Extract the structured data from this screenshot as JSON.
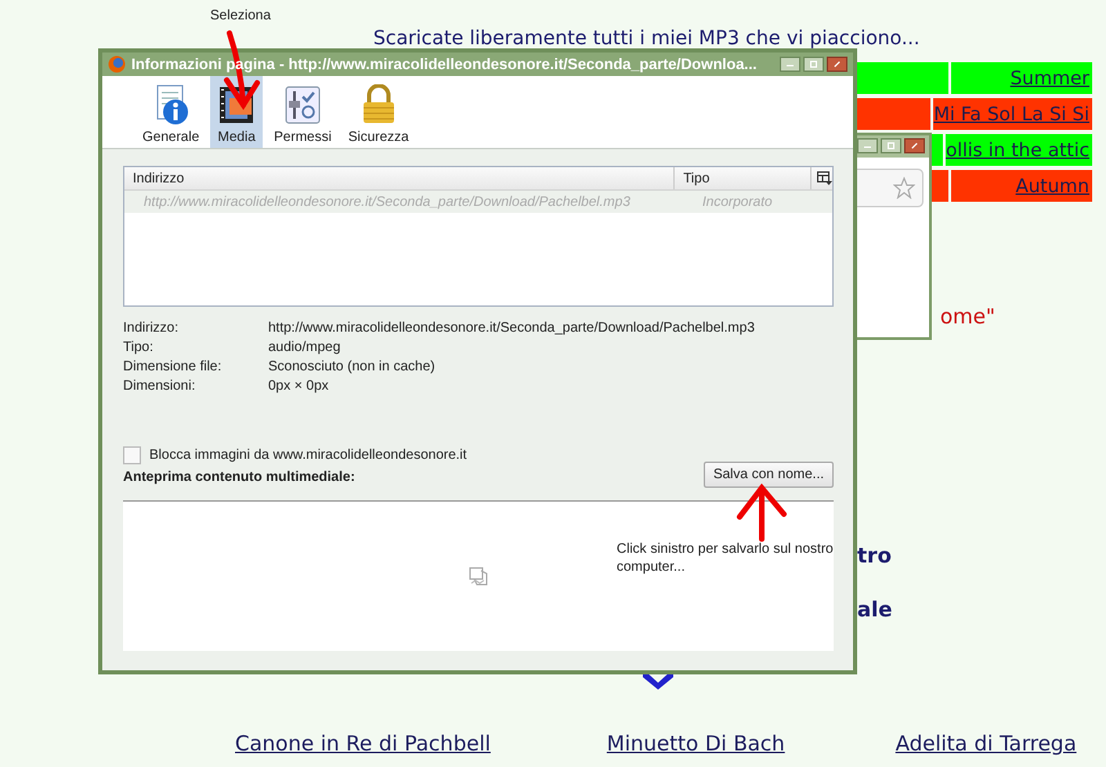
{
  "page": {
    "heading": "Scaricate liberamente tutti i miei MP3 che vi piacciono...",
    "table_rows": [
      {
        "label": "Summer",
        "color": "#00ff00"
      },
      {
        "label": "Mi Fa Sol La Si Si",
        "color": "#ff3300"
      },
      {
        "label": "ollis in the attic",
        "color": "#00ff00"
      },
      {
        "label": "Autumn",
        "color": "#ff3300"
      }
    ],
    "fragments": [
      {
        "text": "ome\"",
        "kind": "red"
      },
      {
        "text": "tro",
        "kind": "bold"
      },
      {
        "text": "ale",
        "kind": "bold"
      }
    ],
    "links": [
      "Canone in Re di Pachbell",
      "Minuetto Di Bach",
      "Adelita di Tarrega"
    ]
  },
  "annotations": {
    "top_label": "Seleziona",
    "note": "Click sinistro per salvarlo sul nostro computer..."
  },
  "dialog": {
    "title": "Informazioni pagina - http://www.miracolidelleondesonore.it/Seconda_parte/Downloa...",
    "tabs": [
      {
        "label": "Generale",
        "kind": "info",
        "selected": false
      },
      {
        "label": "Media",
        "kind": "media",
        "selected": true
      },
      {
        "label": "Permessi",
        "kind": "perm",
        "selected": false
      },
      {
        "label": "Sicurezza",
        "kind": "lock",
        "selected": false
      }
    ],
    "columns": [
      "Indirizzo",
      "Tipo"
    ],
    "rows": [
      {
        "address": "http://www.miracolidelleondesonore.it/Seconda_parte/Download/Pachelbel.mp3",
        "type": "Incorporato"
      }
    ],
    "fields": [
      {
        "label": "Indirizzo:",
        "value": "http://www.miracolidelleondesonore.it/Seconda_parte/Download/Pachelbel.mp3"
      },
      {
        "label": "Tipo:",
        "value": "audio/mpeg"
      },
      {
        "label": "Dimensione file:",
        "value": "Sconosciuto (non in cache)"
      },
      {
        "label": "Dimensioni:",
        "value": "0px × 0px"
      }
    ],
    "block_checkbox": {
      "label": "Blocca immagini da www.miracolidelleondesonore.it",
      "checked": false
    },
    "preview_label": "Anteprima contenuto multimediale:",
    "save_button": "Salva con nome..."
  }
}
